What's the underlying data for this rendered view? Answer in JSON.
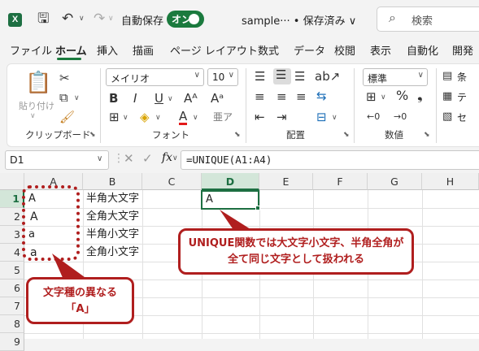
{
  "titlebar": {
    "app_logo": "X",
    "autosave_label": "自動保存",
    "autosave_toggle": "オン",
    "doc_title": "sample··· • 保存済み ∨",
    "search_placeholder": "検索"
  },
  "tabs": [
    "ファイル",
    "ホーム",
    "挿入",
    "描画",
    "ページ レイアウト",
    "数式",
    "データ",
    "校閲",
    "表示",
    "自動化",
    "開発"
  ],
  "active_tab": "ホーム",
  "ribbon": {
    "clipboard": {
      "paste_label": "貼り付け",
      "group_label": "クリップボード"
    },
    "font": {
      "font_name": "メイリオ",
      "font_size": "10",
      "bold": "B",
      "italic": "I",
      "underline": "U",
      "font_color_glyph": "A",
      "group_label": "フォント"
    },
    "alignment": {
      "group_label": "配置"
    },
    "number": {
      "format": "標準",
      "percent": "%",
      "group_label": "数値"
    },
    "styles": {
      "items": [
        "条",
        "テ",
        "セ"
      ]
    }
  },
  "formula_bar": {
    "name_box": "D1",
    "fx": "fx",
    "formula": "=UNIQUE(A1:A4)"
  },
  "sheet": {
    "columns": [
      "A",
      "B",
      "C",
      "D",
      "E",
      "F",
      "G",
      "H"
    ],
    "rows": [
      "1",
      "2",
      "3",
      "4",
      "5",
      "6",
      "7",
      "8",
      "9",
      "10"
    ],
    "cells": {
      "A1": "A",
      "A2": "A",
      "A3": "a",
      "A4": "a",
      "B1": "半角大文字",
      "B2": "全角大文字",
      "B3": "半角小文字",
      "B4": "全角小文字",
      "D1": "A"
    },
    "selected_cell": "D1"
  },
  "annotations": {
    "callout_unique_line1": "UNIQUE関数では大文字小文字、半角全角が",
    "callout_unique_line2": "全て同じ文字として扱われる",
    "callout_chars_line1": "文字種の異なる",
    "callout_chars_line2": "「A」",
    "accent_color": "#b01e1e"
  },
  "colors": {
    "excel_green": "#1d6f42",
    "toggle_green": "#1b7a3e"
  }
}
